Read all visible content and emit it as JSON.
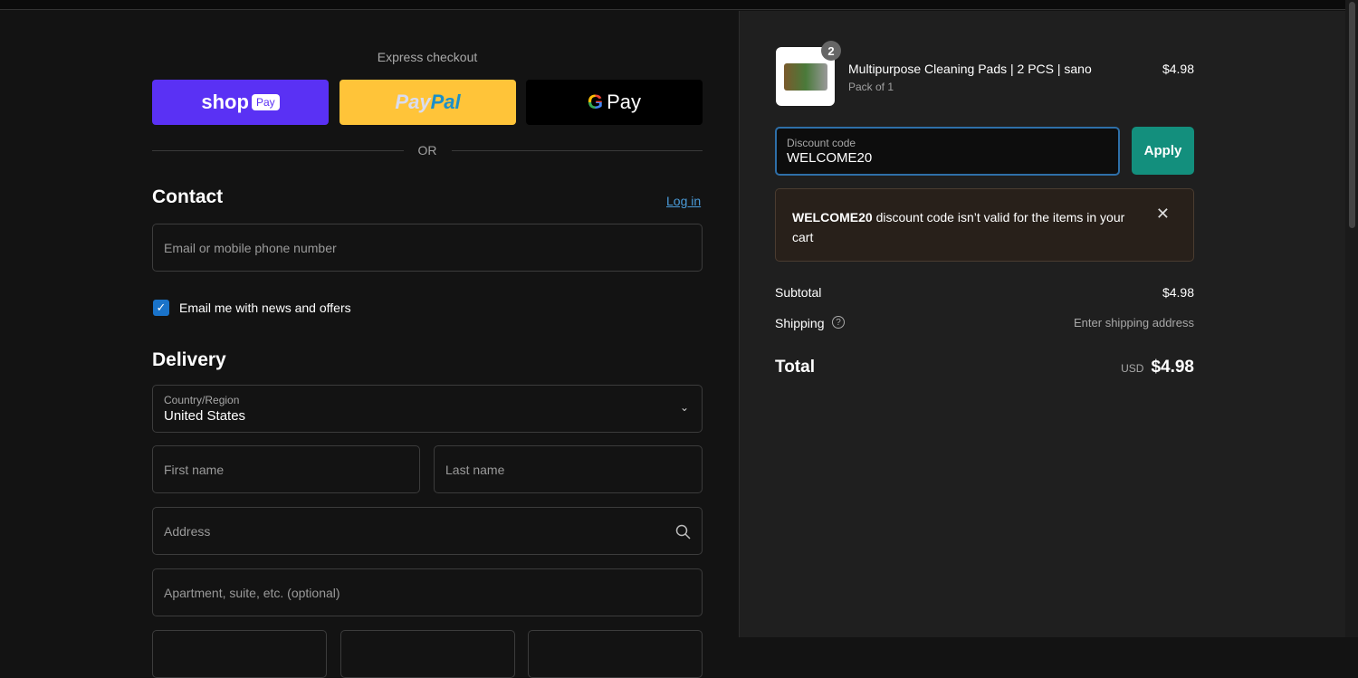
{
  "express": {
    "title": "Express checkout",
    "shop_pay": {
      "brand": "shop",
      "pill": "Pay"
    },
    "paypal": {
      "part1": "Pay",
      "part2": "Pal"
    },
    "gpay": {
      "g": "G",
      "label": "Pay"
    },
    "or": "OR"
  },
  "contact": {
    "title": "Contact",
    "login": "Log in",
    "email_placeholder": "Email or mobile phone number",
    "newsletter_label": "Email me with news and offers",
    "newsletter_checked": true
  },
  "delivery": {
    "title": "Delivery",
    "country_label": "Country/Region",
    "country_value": "United States",
    "first_name": "First name",
    "last_name": "Last name",
    "address": "Address",
    "apartment": "Apartment, suite, etc. (optional)"
  },
  "cart": {
    "item": {
      "name": "Multipurpose Cleaning Pads | 2 PCS | sano",
      "variant": "Pack of 1",
      "price": "$4.98",
      "quantity": "2"
    },
    "discount": {
      "label": "Discount code",
      "value": "WELCOME20",
      "apply": "Apply"
    },
    "error": {
      "code": "WELCOME20",
      "message": " discount code isn’t valid for the items in your cart"
    },
    "subtotal_label": "Subtotal",
    "subtotal": "$4.98",
    "shipping_label": "Shipping",
    "shipping_value": "Enter shipping address",
    "total_label": "Total",
    "currency": "USD",
    "total": "$4.98"
  },
  "colors": {
    "shop_pay": "#5a31f4",
    "paypal": "#ffc439",
    "apply": "#138f7d",
    "link": "#4a9bd9"
  }
}
